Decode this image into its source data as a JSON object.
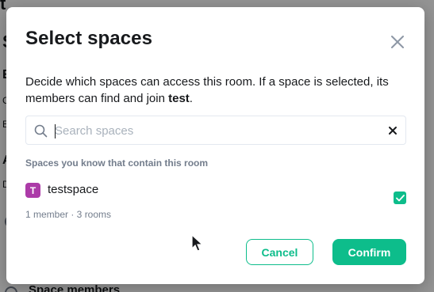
{
  "background": {
    "texts": [
      "t",
      "S",
      "E",
      "C",
      "E",
      "A",
      "D",
      "Space members"
    ]
  },
  "dialog": {
    "title": "Select spaces",
    "description_prefix": "Decide which spaces can access this room. If a space is selected, its members can find and join ",
    "room_name": "test",
    "description_suffix": ".",
    "search": {
      "placeholder": "Search spaces",
      "value": ""
    },
    "section_label": "Spaces you know that contain this room",
    "spaces": [
      {
        "avatar_letter": "T",
        "name": "testspace",
        "meta": "1 member · 3 rooms",
        "selected": true,
        "avatar_color": "#ac3ba8"
      }
    ],
    "buttons": {
      "cancel": "Cancel",
      "confirm": "Confirm"
    }
  },
  "colors": {
    "accent": "#0dbd8b",
    "text": "#17191c",
    "muted": "#737d8c"
  },
  "icons": {
    "close": "close-icon",
    "search": "search-icon",
    "clear": "clear-icon",
    "check": "check-icon"
  }
}
